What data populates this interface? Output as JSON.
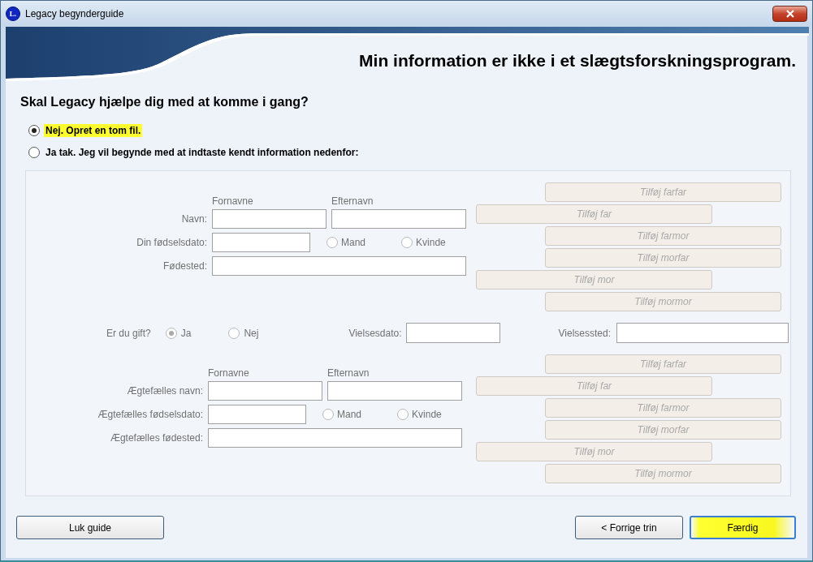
{
  "window": {
    "title": "Legacy begynderguide",
    "app_icon_text": "L."
  },
  "banner": {
    "heading": "Min information er ikke i et slægtsforskningsprogram."
  },
  "question": "Skal Legacy hjælpe dig med at komme i gang?",
  "options": [
    {
      "label": "Nej. Opret en tom fil.",
      "selected": true,
      "highlighted": true
    },
    {
      "label": "Ja tak. Jeg vil begynde med at indtaste kendt information nedenfor:",
      "selected": false,
      "highlighted": false
    }
  ],
  "form": {
    "disabled": true,
    "person": {
      "columns": [
        "Fornavne",
        "Efternavn"
      ],
      "name_label": "Navn:",
      "birthdate_label": "Din fødselsdato:",
      "gender": [
        {
          "label": "Mand",
          "selected": false
        },
        {
          "label": "Kvinde",
          "selected": false
        }
      ],
      "birthplace_label": "Fødested:",
      "ancestors": [
        {
          "label": "Tilføj farfar",
          "kind": "grandparent"
        },
        {
          "label": "Tilføj far",
          "kind": "parent"
        },
        {
          "label": "Tilføj farmor",
          "kind": "grandparent"
        },
        {
          "label": "Tilføj morfar",
          "kind": "grandparent"
        },
        {
          "label": "Tilføj mor",
          "kind": "parent"
        },
        {
          "label": "Tilføj mormor",
          "kind": "grandparent"
        }
      ]
    },
    "marriage": {
      "label": "Er du gift?",
      "options": [
        {
          "label": "Ja",
          "selected": true
        },
        {
          "label": "Nej",
          "selected": false
        }
      ],
      "date_label": "Vielsesdato:",
      "place_label": "Vielsessted:"
    },
    "spouse": {
      "columns": [
        "Fornavne",
        "Efternavn"
      ],
      "name_label": "Ægtefælles navn:",
      "birthdate_label": "Ægtefælles fødselsdato:",
      "gender": [
        {
          "label": "Mand",
          "selected": false
        },
        {
          "label": "Kvinde",
          "selected": false
        }
      ],
      "birthplace_label": "Ægtefælles fødested:",
      "ancestors": [
        {
          "label": "Tilføj farfar",
          "kind": "grandparent"
        },
        {
          "label": "Tilføj far",
          "kind": "parent"
        },
        {
          "label": "Tilføj farmor",
          "kind": "grandparent"
        },
        {
          "label": "Tilføj morfar",
          "kind": "grandparent"
        },
        {
          "label": "Tilføj mor",
          "kind": "parent"
        },
        {
          "label": "Tilføj mormor",
          "kind": "grandparent"
        }
      ]
    }
  },
  "buttons": [
    {
      "label": "Luk guide",
      "kind": "close",
      "highlighted": false
    },
    {
      "label": "< Forrige trin",
      "kind": "back",
      "highlighted": false
    },
    {
      "label": "Færdig",
      "kind": "finish",
      "highlighted": true
    }
  ]
}
